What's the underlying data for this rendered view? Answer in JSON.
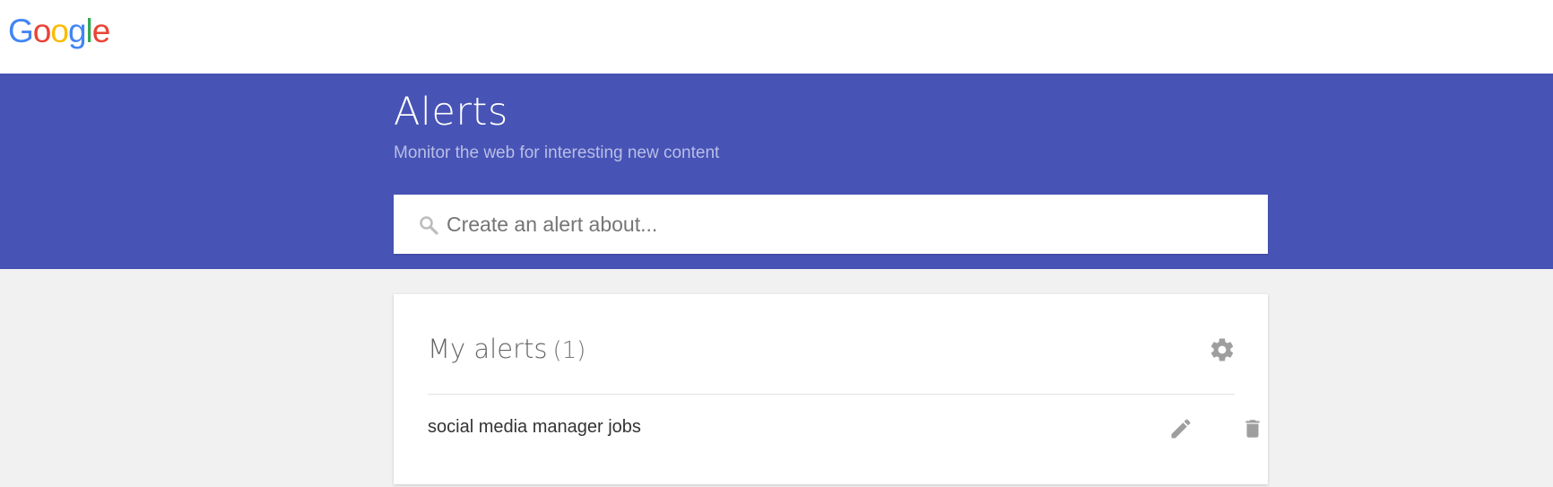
{
  "logo": {
    "letters": [
      "G",
      "o",
      "o",
      "g",
      "l",
      "e"
    ],
    "colors": [
      "#4285f4",
      "#ea4335",
      "#fbbc05",
      "#4285f4",
      "#34a853",
      "#ea4335"
    ]
  },
  "header": {
    "title": "Alerts",
    "subtitle": "Monitor the web for interesting new content",
    "background": "#4753b5"
  },
  "search": {
    "placeholder": "Create an alert about...",
    "value": "",
    "icon": "search-icon"
  },
  "alerts_card": {
    "title": "My alerts",
    "count": "(1)",
    "settings_icon": "gear-icon",
    "items": [
      {
        "label": "social media manager jobs",
        "edit_icon": "pencil-icon",
        "delete_icon": "trash-icon"
      }
    ]
  }
}
